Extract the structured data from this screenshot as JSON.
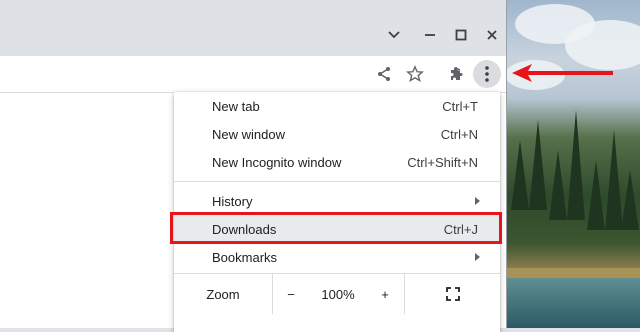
{
  "window_controls": {
    "tab_search_icon": "chevron-down-icon",
    "minimize_icon": "minimize-icon",
    "maximize_icon": "maximize-icon",
    "close_icon": "close-icon"
  },
  "toolbar": {
    "icons": [
      "share-icon",
      "star-icon",
      "extensions-icon",
      "more-vert-icon"
    ]
  },
  "menu": {
    "items": [
      {
        "label": "New tab",
        "shortcut": "Ctrl+T"
      },
      {
        "label": "New window",
        "shortcut": "Ctrl+N"
      },
      {
        "label": "New Incognito window",
        "shortcut": "Ctrl+Shift+N"
      },
      {
        "label": "History",
        "shortcut": ""
      },
      {
        "label": "Downloads",
        "shortcut": "Ctrl+J"
      },
      {
        "label": "Bookmarks",
        "shortcut": ""
      }
    ],
    "zoom": {
      "label": "Zoom",
      "minus": "−",
      "value": "100%",
      "plus": "+"
    }
  },
  "annotation": {
    "highlight_color": "#e8141b",
    "arrow_color": "#e8141b"
  }
}
